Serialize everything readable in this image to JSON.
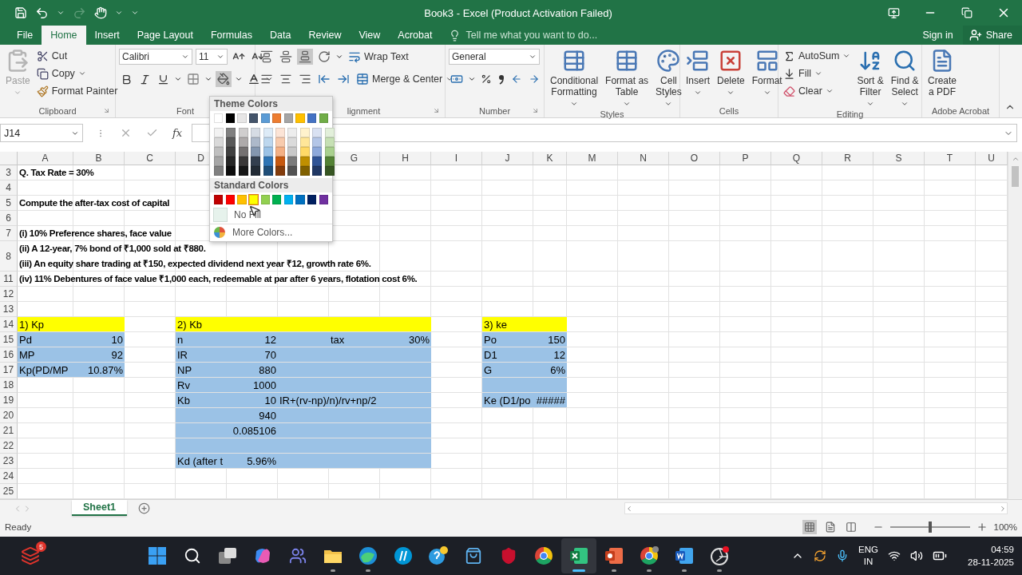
{
  "title_bar": {
    "title": "Book3 - Excel (Product Activation Failed)",
    "redo_disabled": true
  },
  "tabs": [
    {
      "label": "File",
      "selected": false
    },
    {
      "label": "Home",
      "selected": true
    },
    {
      "label": "Insert",
      "selected": false
    },
    {
      "label": "Page Layout",
      "selected": false
    },
    {
      "label": "Formulas",
      "selected": false
    },
    {
      "label": "Data",
      "selected": false
    },
    {
      "label": "Review",
      "selected": false
    },
    {
      "label": "View",
      "selected": false
    },
    {
      "label": "Acrobat",
      "selected": false
    }
  ],
  "tell_me": {
    "placeholder": "Tell me what you want to do..."
  },
  "account": {
    "sign_in": "Sign in",
    "share": "Share"
  },
  "ribbon": {
    "clipboard": {
      "label": "Clipboard",
      "paste": "Paste",
      "paste_disabled": true,
      "cut": "Cut",
      "copy": "Copy",
      "format_painter": "Format Painter"
    },
    "font": {
      "label": "Font",
      "font_name": "Calibri",
      "font_size": "11"
    },
    "alignment": {
      "label": "lignment",
      "wrap_text": "Wrap Text",
      "merge": "Merge & Center"
    },
    "number": {
      "label": "Number",
      "format": "General"
    },
    "styles": {
      "label": "Styles",
      "buttons": [
        {
          "lines": [
            "Conditional",
            "Formatting"
          ]
        },
        {
          "lines": [
            "Format as",
            "Table"
          ]
        },
        {
          "lines": [
            "Cell",
            "Styles"
          ]
        }
      ]
    },
    "cells": {
      "label": "Cells",
      "buttons": [
        {
          "lines": [
            "Insert"
          ]
        },
        {
          "lines": [
            "Delete"
          ]
        },
        {
          "lines": [
            "Format"
          ]
        }
      ]
    },
    "editing": {
      "label": "Editing",
      "small": [
        "AutoSum",
        "Fill",
        "Clear"
      ],
      "large": [
        {
          "lines": [
            "Sort &",
            "Filter"
          ]
        },
        {
          "lines": [
            "Find &",
            "Select"
          ]
        }
      ]
    },
    "acrobat": {
      "label": "Adobe Acrobat",
      "button": {
        "lines": [
          "Create",
          "a PDF"
        ]
      }
    }
  },
  "formula_bar": {
    "name_box": "J14",
    "fx": "fx"
  },
  "sheet": {
    "columns": [
      "A",
      "B",
      "C",
      "D",
      null,
      null,
      "G",
      "H",
      "I",
      "J",
      "K",
      "M",
      "N",
      "O",
      "P",
      "Q",
      "R",
      "S",
      "T",
      "U"
    ],
    "rows": [
      {
        "label": "3",
        "cells": [
          {
            "kind": "question",
            "text": "Q. Tax Rate = 30%"
          }
        ]
      },
      {
        "label": "4"
      },
      {
        "label": "5",
        "cells": [
          {
            "kind": "question",
            "text": "Compute the after-tax cost of capital"
          }
        ]
      },
      {
        "label": "6"
      },
      {
        "label": "7",
        "cells": [
          {
            "kind": "question",
            "text": "(i) 10% Preference shares, face value"
          }
        ]
      },
      {
        "label": "8",
        "cells": [
          {
            "kind": "question",
            "lines": [
              "(ii) A 12-year, 7% bond of ₹1,000 sold at ₹880.",
              "(iii) An equity share trading at ₹150, expected dividend next year ₹12, growth rate 6%."
            ]
          }
        ]
      },
      {
        "label": "11",
        "cells": [
          {
            "kind": "question",
            "text": "(iv) 11% Debentures of face value ₹1,000 each, redeemable at par after 6 years, flotation cost 6%."
          }
        ]
      },
      {
        "label": "12"
      },
      {
        "label": "13"
      },
      {
        "label": "14",
        "cells": [
          {
            "kind": "label",
            "text": "1) Kp",
            "color": "#ffff00"
          },
          {
            "color": "#ffff00"
          },
          null,
          {
            "kind": "label",
            "text": "2) Kb",
            "color": "#ffff00"
          },
          {
            "color": "#ffff00"
          },
          {
            "color": "#ffff00"
          },
          {
            "color": "#ffff00"
          },
          {
            "color": "#ffff00"
          },
          null,
          {
            "kind": "label",
            "text": "3) ke",
            "color": "#ffff00"
          },
          {
            "color": "#ffff00"
          }
        ]
      },
      {
        "label": "15",
        "cells": [
          {
            "kind": "label",
            "text": "Pd",
            "color": "#9bc2e6"
          },
          {
            "kind": "number",
            "text": "10",
            "color": "#9bc2e6"
          },
          null,
          {
            "kind": "label",
            "text": "n",
            "color": "#9bc2e6"
          },
          {
            "kind": "number",
            "text": "12",
            "color": "#9bc2e6"
          },
          {
            "color": "#9bc2e6"
          },
          {
            "kind": "label",
            "text": "tax",
            "color": "#9bc2e6"
          },
          {
            "kind": "number",
            "text": "30%",
            "color": "#9bc2e6"
          },
          null,
          {
            "kind": "label",
            "text": "Po",
            "color": "#9bc2e6"
          },
          {
            "kind": "number",
            "text": "150",
            "color": "#9bc2e6"
          }
        ]
      },
      {
        "label": "16",
        "cells": [
          {
            "kind": "label",
            "text": "MP",
            "color": "#9bc2e6"
          },
          {
            "kind": "number",
            "text": "92",
            "color": "#9bc2e6"
          },
          null,
          {
            "kind": "label",
            "text": "IR",
            "color": "#9bc2e6"
          },
          {
            "kind": "number",
            "text": "70",
            "color": "#9bc2e6"
          },
          {
            "color": "#9bc2e6"
          },
          {
            "color": "#9bc2e6"
          },
          {
            "color": "#9bc2e6"
          },
          null,
          {
            "kind": "label",
            "text": "D1",
            "color": "#9bc2e6"
          },
          {
            "kind": "number",
            "text": "12",
            "color": "#9bc2e6"
          }
        ]
      },
      {
        "label": "17",
        "cells": [
          {
            "kind": "label",
            "text": "Kp(PD/MP",
            "color": "#9bc2e6"
          },
          {
            "kind": "number",
            "text": "10.87%",
            "color": "#9bc2e6"
          },
          null,
          {
            "kind": "label",
            "text": "NP",
            "color": "#9bc2e6"
          },
          {
            "kind": "number",
            "text": "880",
            "color": "#9bc2e6"
          },
          {
            "color": "#9bc2e6"
          },
          {
            "color": "#9bc2e6"
          },
          {
            "color": "#9bc2e6"
          },
          null,
          {
            "kind": "label",
            "text": "G",
            "color": "#9bc2e6"
          },
          {
            "kind": "number",
            "text": "6%",
            "color": "#9bc2e6"
          }
        ]
      },
      {
        "label": "18",
        "cells": [
          null,
          null,
          null,
          {
            "kind": "label",
            "text": "Rv",
            "color": "#9bc2e6"
          },
          {
            "kind": "number",
            "text": "1000",
            "color": "#9bc2e6"
          },
          {
            "color": "#9bc2e6"
          },
          {
            "color": "#9bc2e6"
          },
          {
            "color": "#9bc2e6"
          },
          null,
          {
            "color": "#9bc2e6"
          },
          {
            "color": "#9bc2e6"
          }
        ]
      },
      {
        "label": "19",
        "cells": [
          null,
          null,
          null,
          {
            "kind": "label",
            "text": "Kb",
            "color": "#9bc2e6"
          },
          {
            "kind": "number",
            "text": "10",
            "color": "#9bc2e6"
          },
          {
            "kind": "label",
            "text": "IR+(rv-np)/n)/rv+np/2",
            "color": "#9bc2e6"
          },
          {
            "color": "#9bc2e6"
          },
          {
            "color": "#9bc2e6"
          },
          null,
          {
            "kind": "label",
            "text": "Ke (D1/po",
            "color": "#9bc2e6"
          },
          {
            "kind": "number",
            "text": "#####",
            "color": "#9bc2e6"
          }
        ]
      },
      {
        "label": "20",
        "cells": [
          null,
          null,
          null,
          {
            "color": "#9bc2e6"
          },
          {
            "kind": "number",
            "text": "940",
            "color": "#9bc2e6"
          },
          {
            "color": "#9bc2e6"
          },
          {
            "color": "#9bc2e6"
          },
          {
            "color": "#9bc2e6"
          }
        ]
      },
      {
        "label": "21",
        "cells": [
          null,
          null,
          null,
          {
            "color": "#9bc2e6"
          },
          {
            "kind": "number",
            "text": "0.085106",
            "color": "#9bc2e6"
          },
          {
            "color": "#9bc2e6"
          },
          {
            "color": "#9bc2e6"
          },
          {
            "color": "#9bc2e6"
          }
        ]
      },
      {
        "label": "22",
        "cells": [
          null,
          null,
          null,
          {
            "color": "#9bc2e6"
          },
          {
            "color": "#9bc2e6"
          },
          {
            "color": "#9bc2e6"
          },
          {
            "color": "#9bc2e6"
          },
          {
            "color": "#9bc2e6"
          }
        ]
      },
      {
        "label": "23",
        "cells": [
          null,
          null,
          null,
          {
            "kind": "label",
            "text": "Kd (after t",
            "color": "#9bc2e6"
          },
          {
            "kind": "number",
            "text": "5.96%",
            "color": "#9bc2e6"
          },
          {
            "color": "#9bc2e6"
          },
          {
            "color": "#9bc2e6"
          },
          {
            "color": "#9bc2e6"
          }
        ]
      },
      {
        "label": "24"
      },
      {
        "label": "25"
      }
    ]
  },
  "fill_menu": {
    "theme_heading": "Theme Colors",
    "theme_colors": [
      {
        "color": "#ffffff",
        "shades": [
          {
            "color": "#f2f2f2"
          },
          {
            "color": "#d9d9d9"
          },
          {
            "color": "#bfbfbf"
          },
          {
            "color": "#a6a6a6"
          },
          {
            "color": "#808080"
          }
        ]
      },
      {
        "color": "#000000",
        "shades": [
          {
            "color": "#808080"
          },
          {
            "color": "#595959"
          },
          {
            "color": "#404040"
          },
          {
            "color": "#262626"
          },
          {
            "color": "#0d0d0d"
          }
        ]
      },
      {
        "color": "#e7e6e6",
        "shades": [
          {
            "color": "#d0cece"
          },
          {
            "color": "#aeaaaa"
          },
          {
            "color": "#757171"
          },
          {
            "color": "#3a3838"
          },
          {
            "color": "#161616"
          }
        ]
      },
      {
        "color": "#44546a",
        "shades": [
          {
            "color": "#d6dce4"
          },
          {
            "color": "#adb9ca"
          },
          {
            "color": "#8497b0"
          },
          {
            "color": "#333f4f"
          },
          {
            "color": "#222b35"
          }
        ]
      },
      {
        "color": "#5b9bd5",
        "shades": [
          {
            "color": "#ddebf7"
          },
          {
            "color": "#bdd7ee"
          },
          {
            "color": "#9bc2e6"
          },
          {
            "color": "#2f75b5"
          },
          {
            "color": "#1f4e78"
          }
        ]
      },
      {
        "color": "#ed7d31",
        "shades": [
          {
            "color": "#fce4d6"
          },
          {
            "color": "#f8cbad"
          },
          {
            "color": "#f4b084"
          },
          {
            "color": "#c65911"
          },
          {
            "color": "#833c0c"
          }
        ]
      },
      {
        "color": "#a5a5a5",
        "shades": [
          {
            "color": "#ededed"
          },
          {
            "color": "#dbdbdb"
          },
          {
            "color": "#c9c9c9"
          },
          {
            "color": "#7b7b7b"
          },
          {
            "color": "#525252"
          }
        ]
      },
      {
        "color": "#ffc000",
        "shades": [
          {
            "color": "#fff2cc"
          },
          {
            "color": "#ffe699"
          },
          {
            "color": "#ffd966"
          },
          {
            "color": "#bf8f00"
          },
          {
            "color": "#806000"
          }
        ]
      },
      {
        "color": "#4472c4",
        "shades": [
          {
            "color": "#d9e1f2"
          },
          {
            "color": "#b4c6e7"
          },
          {
            "color": "#8ea9db"
          },
          {
            "color": "#305496"
          },
          {
            "color": "#203764"
          }
        ]
      },
      {
        "color": "#70ad47",
        "shades": [
          {
            "color": "#e2efda"
          },
          {
            "color": "#c6e0b4"
          },
          {
            "color": "#a9d08e"
          },
          {
            "color": "#548235"
          },
          {
            "color": "#375623"
          }
        ]
      }
    ],
    "standard_heading": "Standard Colors",
    "standard_colors": [
      {
        "color": "#c00000",
        "highlighted": false
      },
      {
        "color": "#ff0000",
        "highlighted": false
      },
      {
        "color": "#ffc000",
        "highlighted": false
      },
      {
        "color": "#ffff00",
        "highlighted": true
      },
      {
        "color": "#92d050",
        "highlighted": false
      },
      {
        "color": "#00b050",
        "highlighted": false
      },
      {
        "color": "#00b0f0",
        "highlighted": false
      },
      {
        "color": "#0070c0",
        "highlighted": false
      },
      {
        "color": "#002060",
        "highlighted": false
      },
      {
        "color": "#7030a0",
        "highlighted": false
      }
    ],
    "no_fill": "No Fill",
    "more_colors": "More Colors..."
  },
  "sheet_tabs": [
    {
      "label": "Sheet1",
      "selected": true
    }
  ],
  "status_bar": {
    "status": "Ready",
    "views": [
      {
        "selected": true
      },
      {
        "selected": false
      },
      {
        "selected": false
      }
    ],
    "zoom": {
      "level": 0.5,
      "reading": "100%"
    }
  },
  "taskbar": {
    "badge": "5",
    "apps": [
      {
        "running": false,
        "active": false
      },
      {
        "running": false,
        "active": false
      },
      {
        "running": false,
        "active": false
      },
      {
        "running": false,
        "active": false
      },
      {
        "running": false,
        "active": false
      },
      {
        "running": true,
        "active": false
      },
      {
        "running": true,
        "active": false
      },
      {
        "running": false,
        "active": false
      },
      {
        "running": false,
        "active": false
      },
      {
        "running": false,
        "active": false
      },
      {
        "running": false,
        "active": false
      },
      {
        "running": false,
        "active": false
      },
      {
        "running": true,
        "active": true
      },
      {
        "running": true,
        "active": false
      },
      {
        "running": true,
        "active": false
      },
      {
        "running": true,
        "active": false
      },
      {
        "running": true,
        "active": false
      }
    ],
    "language": [
      "ENG",
      "IN"
    ],
    "time": "04:59",
    "date": "28-11-2025"
  }
}
